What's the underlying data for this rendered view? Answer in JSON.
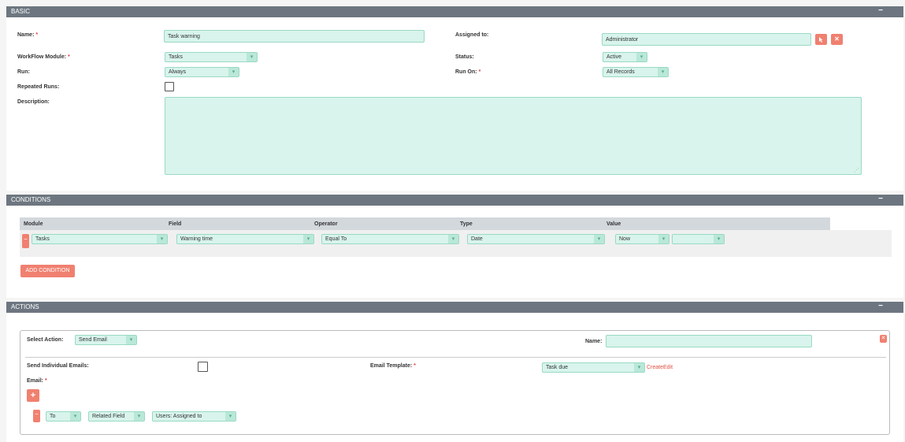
{
  "basic": {
    "title": "BASIC",
    "collapse": "−",
    "name_label": "Name:",
    "name_value": "Task warning",
    "assigned_label": "Assigned to:",
    "assigned_value": "Administrator",
    "module_label": "WorkFlow Module:",
    "module_value": "Tasks",
    "status_label": "Status:",
    "status_value": "Active",
    "run_label": "Run:",
    "run_value": "Always",
    "run_on_label": "Run On:",
    "run_on_value": "All Records",
    "repeated_label": "Repeated Runs:",
    "description_label": "Description:",
    "required_mark": "*"
  },
  "conditions": {
    "title": "CONDITIONS",
    "collapse": "−",
    "headers": [
      "Module",
      "Field",
      "Operator",
      "Type",
      "Value"
    ],
    "row": {
      "module": "Tasks",
      "field": "Warning time",
      "operator": "Equal To",
      "type": "Date",
      "value1": "Now",
      "value2": ""
    },
    "add_button": "ADD CONDITION"
  },
  "actions": {
    "title": "ACTIONS",
    "collapse": "−",
    "select_action_label": "Select Action:",
    "select_action_value": "Send Email",
    "name_label": "Name:",
    "send_individual_label": "Send Individual Emails:",
    "email_template_label": "Email Template:",
    "email_template_value": "Task due",
    "create_link": "Create",
    "edit_link": "Edit",
    "email_label": "Email:",
    "add_icon": "+",
    "email_row": {
      "to": "To",
      "type": "Related Field",
      "field": "Users: Assigned to"
    }
  },
  "icons": {
    "select": "cursor-select-icon",
    "clear": "clear-x-icon",
    "remove": "minus-icon",
    "arrow": "chevron-down-icon",
    "resize": "resize-grip-icon"
  },
  "colors": {
    "header": "#6d7680",
    "field_bg": "#d8f4ec",
    "accent_red": "#f08070"
  }
}
